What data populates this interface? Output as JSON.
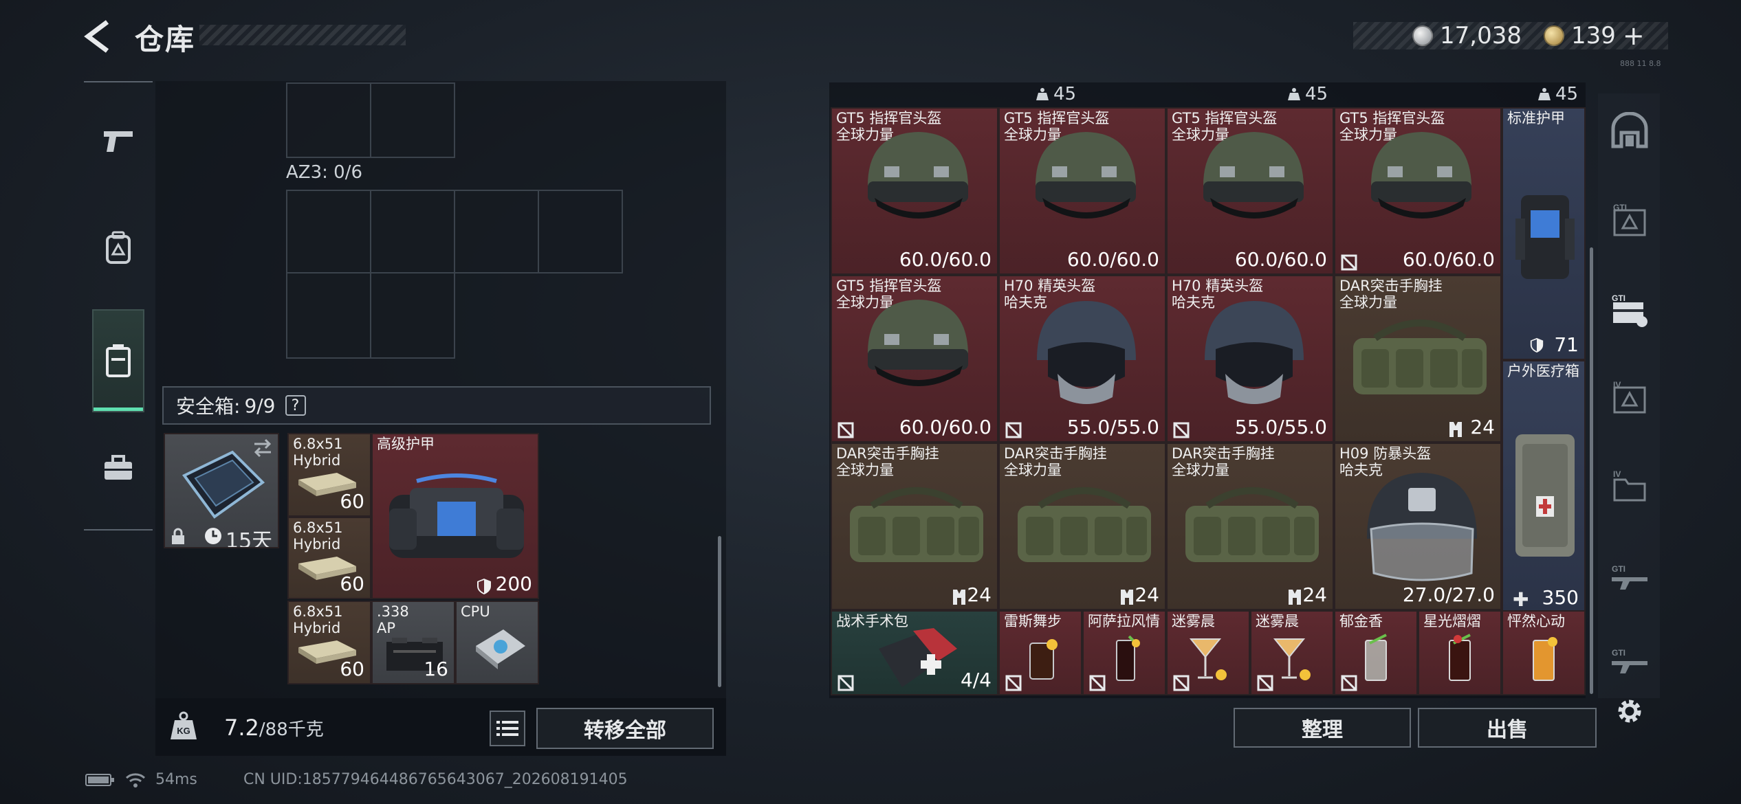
{
  "header": {
    "title": "仓库",
    "currency_silver": "17,038",
    "currency_gold": "139",
    "add_symbol": "+",
    "build_tag": "888 11 8.8"
  },
  "left_nav": [
    "weapon",
    "backpack",
    "safebox",
    "toolbox"
  ],
  "safe_area": {
    "az3_label": "AZ3: 0/6",
    "safebox_label": "安全箱:",
    "safebox_count": "9/9",
    "help": "?"
  },
  "safebox_items": {
    "case_timer": "15天",
    "ammo1_name": "6.8x51\nHybrid",
    "ammo1_count": "60",
    "ammo2_name": "6.8x51\nHybrid",
    "ammo2_count": "60",
    "ammo3_name": "6.8x51\nHybrid",
    "ammo3_count": "60",
    "armor_name": "高级护甲",
    "armor_value": "200",
    "ap_name": ".338\nAP",
    "ap_count": "16",
    "cpu_name": "CPU"
  },
  "bottom_left": {
    "weight_value": "7.2",
    "weight_max": "/88千克",
    "transfer_all": "转移全部"
  },
  "status": {
    "ping": "54ms",
    "uid": "CN UID:18577946448676564306​7_202608191405"
  },
  "stash": {
    "weights": [
      "45",
      "45",
      "45"
    ],
    "items": [
      {
        "name": "GT5 指挥官头盔\n全球力量",
        "value": "60.0/60.0"
      },
      {
        "name": "GT5 指挥官头盔\n全球力量",
        "value": "60.0/60.0"
      },
      {
        "name": "GT5 指挥官头盔\n全球力量",
        "value": "60.0/60.0"
      },
      {
        "name": "GT5 指挥官头盔\n全球力量",
        "value": "60.0/60.0"
      },
      {
        "name": "标准护甲",
        "value": "71"
      },
      {
        "name": "GT5 指挥官头盔\n全球力量",
        "value": "60.0/60.0"
      },
      {
        "name": "H70 精英头盔\n哈夫克",
        "value": "55.0/55.0"
      },
      {
        "name": "H70 精英头盔\n哈夫克",
        "value": "55.0/55.0"
      },
      {
        "name": "DAR突击手胸挂\n全球力量",
        "value": "24"
      },
      {
        "name": "户外医疗箱",
        "value": "350"
      },
      {
        "name": "DAR突击手胸挂\n全球力量",
        "value": "24"
      },
      {
        "name": "DAR突击手胸挂\n全球力量",
        "value": "24"
      },
      {
        "name": "DAR突击手胸挂\n全球力量",
        "value": "24"
      },
      {
        "name": "H09 防暴头盔\n哈夫克",
        "value": "27.0/27.0"
      },
      {
        "name": "战术手术包",
        "value": "4/4"
      },
      {
        "name": "雷斯舞步",
        "value": ""
      },
      {
        "name": "阿萨拉风情",
        "value": ""
      },
      {
        "name": "迷雾晨",
        "value": ""
      },
      {
        "name": "迷雾晨",
        "value": ""
      },
      {
        "name": "郁金香",
        "value": ""
      },
      {
        "name": "星光熠熠",
        "value": ""
      },
      {
        "name": "怦然心动",
        "value": ""
      }
    ]
  },
  "right_tabs": [
    "collection",
    "GTI",
    "GTI",
    "IV",
    "IV",
    "GTI",
    "GTI"
  ],
  "actions": {
    "sort": "整理",
    "sell": "出售"
  },
  "colors": {
    "red_item": "#5e2a30",
    "brown_item": "#4a3b31",
    "blue_item": "#364058",
    "teal_item": "#28403e",
    "accent_green": "#5fe0b0"
  }
}
